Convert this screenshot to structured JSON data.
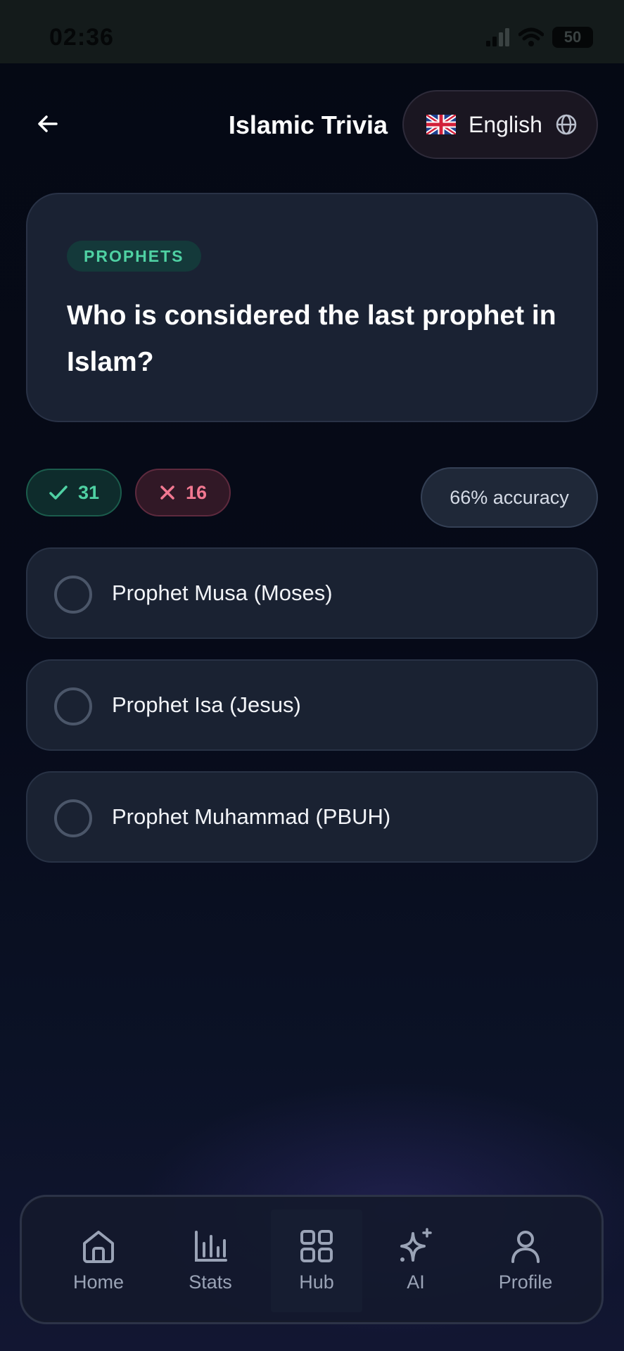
{
  "status_bar": {
    "time": "02:36",
    "battery": "50"
  },
  "header": {
    "title": "Islamic Trivia",
    "language": "English",
    "flag_icon": "uk-flag-icon",
    "globe_icon": "globe-icon",
    "back_icon": "arrow-left-icon"
  },
  "question": {
    "category": "PROPHETS",
    "text": "Who is considered the last prophet in Islam?"
  },
  "stats": {
    "correct": "31",
    "wrong": "16",
    "accuracy": "66% accuracy"
  },
  "answers": [
    {
      "label": "Prophet Musa (Moses)"
    },
    {
      "label": "Prophet Isa (Jesus)"
    },
    {
      "label": "Prophet Muhammad (PBUH)"
    }
  ],
  "nav": {
    "active": "Hub",
    "items": [
      {
        "label": "Home",
        "icon": "home-icon"
      },
      {
        "label": "Stats",
        "icon": "bar-chart-icon"
      },
      {
        "label": "Hub",
        "icon": "grid-icon"
      },
      {
        "label": "AI",
        "icon": "sparkles-icon"
      },
      {
        "label": "Profile",
        "icon": "user-icon"
      }
    ]
  },
  "colors": {
    "accent_green": "#4fd1a3",
    "accent_red": "#f27891",
    "card_bg": "#1a2233",
    "page_bg": "#060a17"
  }
}
